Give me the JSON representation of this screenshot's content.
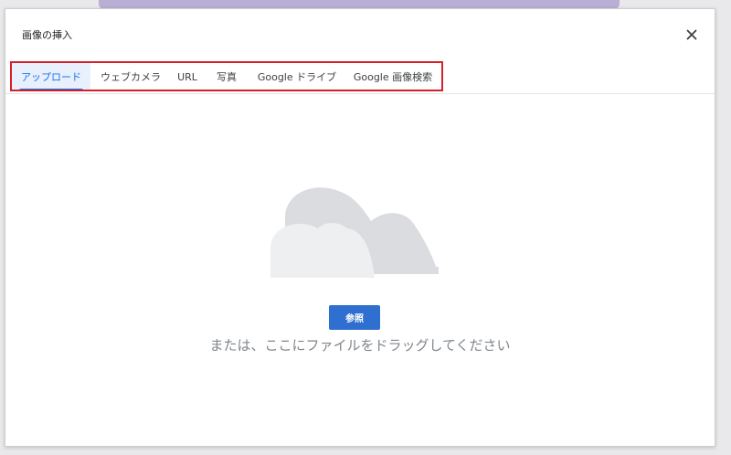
{
  "dialog": {
    "title": "画像の挿入",
    "close_icon": "close-icon"
  },
  "tabs": [
    {
      "label": "アップロード",
      "active": true
    },
    {
      "label": "ウェブカメラ",
      "active": false
    },
    {
      "label": "URL",
      "active": false
    },
    {
      "label": "写真",
      "active": false
    },
    {
      "label": "Google ドライブ",
      "active": false
    },
    {
      "label": "Google 画像検索",
      "active": false
    }
  ],
  "upload": {
    "illustration_icon": "cloud-icon",
    "browse_label": "参照",
    "drop_hint": "または、ここにファイルをドラッグしてください"
  },
  "colors": {
    "accent": "#1a73e8",
    "highlight": "#d4202a",
    "button": "#2f6fd0"
  }
}
